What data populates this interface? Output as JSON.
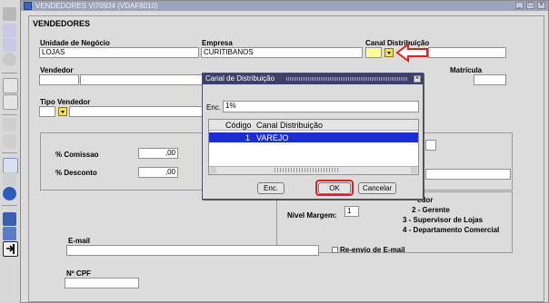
{
  "window": {
    "title": "VENDEDORES VI70934 (VDAF8010)",
    "controls": [
      "_",
      "□",
      "×"
    ]
  },
  "form": {
    "section_title": "VENDEDORES",
    "unidade_label": "Unidade de Negócio",
    "unidade_value": "LOJAS",
    "empresa_label": "Empresa",
    "empresa_value": "CURITIBANOS",
    "canal_label": "Canal Distribuição",
    "vendedor_label": "Vendedor",
    "matricula_label": "Matrícula",
    "tipo_vendedor_label": "Tipo Vendedor",
    "comissao_label": "% Comissao",
    "comissao_value": ",00",
    "desconto_label": "% Desconto",
    "desconto_value": ",00",
    "nivel_margem_label": "Nível Margem:",
    "nivel_margem_value": "1",
    "vendedor_types_header": "edor",
    "vendedor_types": [
      "2 - Gerente",
      "3 - Supervisor de Lojas",
      "4 - Departamento Comercial"
    ],
    "email_label": "E-mail",
    "reenvio_label": "Re-envio de E-mail",
    "cpf_label": "Nº CPF"
  },
  "dialog": {
    "title": "Canal de Distribuição",
    "close": "×",
    "find_label": "Enc.",
    "find_value": "1%",
    "columns": [
      "Código",
      "Canal Distribuição"
    ],
    "rows": [
      {
        "codigo": "1",
        "canal": "VAREJO"
      }
    ],
    "btn_find": "Enc.",
    "btn_ok": "OK",
    "btn_cancel": "Cancelar"
  },
  "colors": {
    "accent_arrow": "#e02020",
    "selected_row": "#1b2bd8"
  }
}
